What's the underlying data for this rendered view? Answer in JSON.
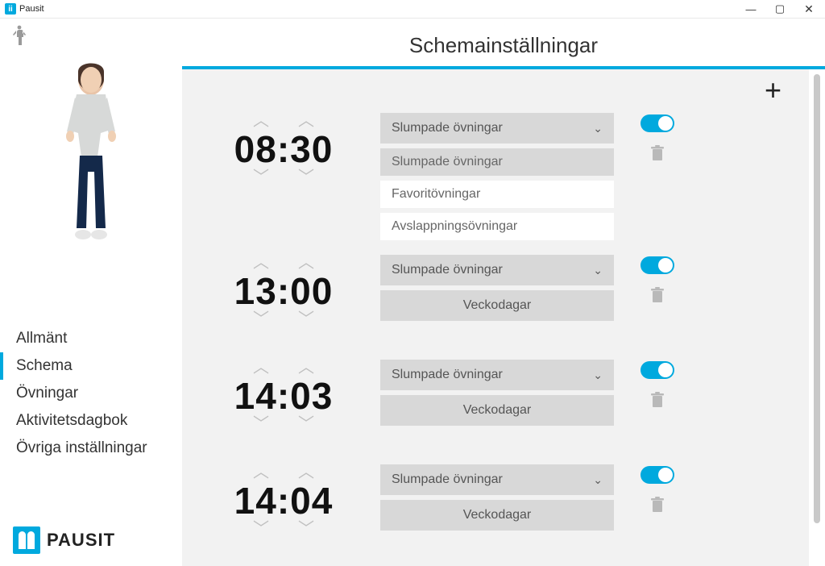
{
  "window": {
    "title": "Pausit"
  },
  "page": {
    "title": "Schemainställningar"
  },
  "sidebar": {
    "items": [
      {
        "label": "Allmänt",
        "active": false
      },
      {
        "label": "Schema",
        "active": true
      },
      {
        "label": "Övningar",
        "active": false
      },
      {
        "label": "Aktivitetsdagbok",
        "active": false
      },
      {
        "label": "Övriga inställningar",
        "active": false
      }
    ],
    "logo_text": "PAUSIT"
  },
  "dropdown": {
    "selected": "Slumpade övningar",
    "options": [
      "Slumpade övningar",
      "Favoritövningar",
      "Avslappningsövningar"
    ]
  },
  "labels": {
    "weekdays": "Veckodagar",
    "exercise_select": "Slumpade övningar"
  },
  "schedule": [
    {
      "hour": "08",
      "minute": "30",
      "exercise": "Slumpade övningar",
      "enabled": true,
      "expanded": true
    },
    {
      "hour": "13",
      "minute": "00",
      "exercise": "Slumpade övningar",
      "enabled": true,
      "expanded": false
    },
    {
      "hour": "14",
      "minute": "03",
      "exercise": "Slumpade övningar",
      "enabled": true,
      "expanded": false
    },
    {
      "hour": "14",
      "minute": "04",
      "exercise": "Slumpade övningar",
      "enabled": true,
      "expanded": false
    }
  ]
}
